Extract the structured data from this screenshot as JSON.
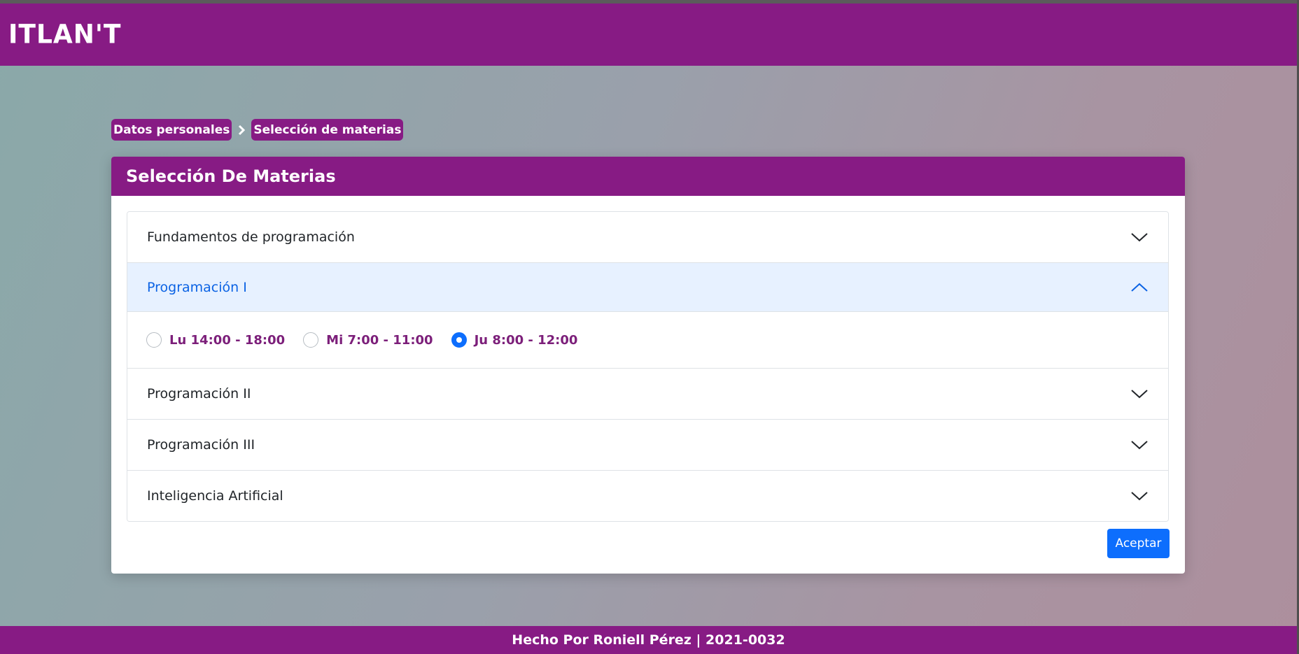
{
  "header": {
    "logo": "ITLAN'T"
  },
  "breadcrumb": {
    "items": [
      {
        "label": "Datos personales"
      },
      {
        "label": "Selección de materias"
      }
    ]
  },
  "card": {
    "title": "Selección De Materias",
    "accordion": [
      {
        "label": "Fundamentos de programación",
        "open": false
      },
      {
        "label": "Programación I",
        "open": true,
        "options": [
          {
            "label": "Lu 14:00 - 18:00",
            "checked": false
          },
          {
            "label": "Mi 7:00 - 11:00",
            "checked": false
          },
          {
            "label": "Ju 8:00 - 12:00",
            "checked": true
          }
        ]
      },
      {
        "label": "Programación II",
        "open": false
      },
      {
        "label": "Programación III",
        "open": false
      },
      {
        "label": "Inteligencia Artificial",
        "open": false
      }
    ],
    "accept_label": "Aceptar"
  },
  "footer": {
    "text": "Hecho Por Roniell Pérez | 2021-0032"
  },
  "colors": {
    "brand": "#871b84",
    "primary": "#0d6efd",
    "accordion_active_bg": "#e7f1ff",
    "accordion_active_text": "#0c63e4"
  },
  "icons": {
    "collapsed": "chevron-down-icon",
    "expanded": "chevron-up-icon",
    "breadcrumb_separator": "chevron-right-icon"
  }
}
